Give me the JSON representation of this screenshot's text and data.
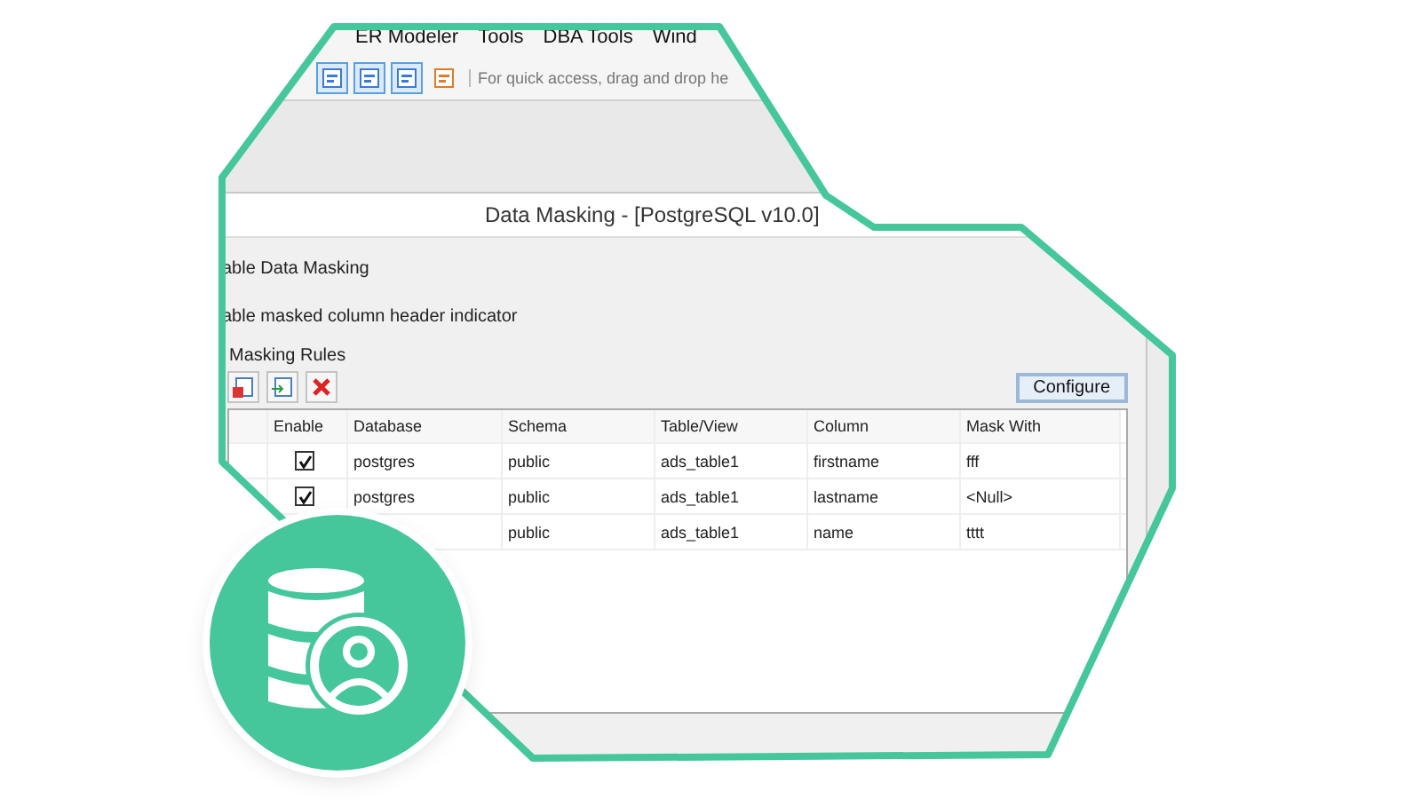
{
  "menu": [
    {
      "label": "ER Modeler"
    },
    {
      "label": "Tools"
    },
    {
      "label": "DBA Tools"
    },
    {
      "label": "Wind"
    }
  ],
  "toolbar": {
    "hint": "For quick access, drag and drop he"
  },
  "dialog": {
    "title": "Data Masking - [PostgreSQL v10.0]",
    "options": [
      "able Data Masking",
      "able masked column header indicator"
    ],
    "group_title": "Masking Rules",
    "configure_button": "Configure",
    "table": {
      "columns": [
        "Enable",
        "Database",
        "Schema",
        "Table/View",
        "Column",
        "Mask With"
      ],
      "rows": [
        {
          "checked": true,
          "database": "postgres",
          "schema": "public",
          "table": "ads_table1",
          "column": "firstname",
          "mask": "fff"
        },
        {
          "checked": true,
          "database": "postgres",
          "schema": "public",
          "table": "ads_table1",
          "column": "lastname",
          "mask": "<Null>"
        },
        {
          "schema": "public",
          "table": "ads_table1",
          "column": "name",
          "mask": "tttt"
        }
      ]
    }
  }
}
